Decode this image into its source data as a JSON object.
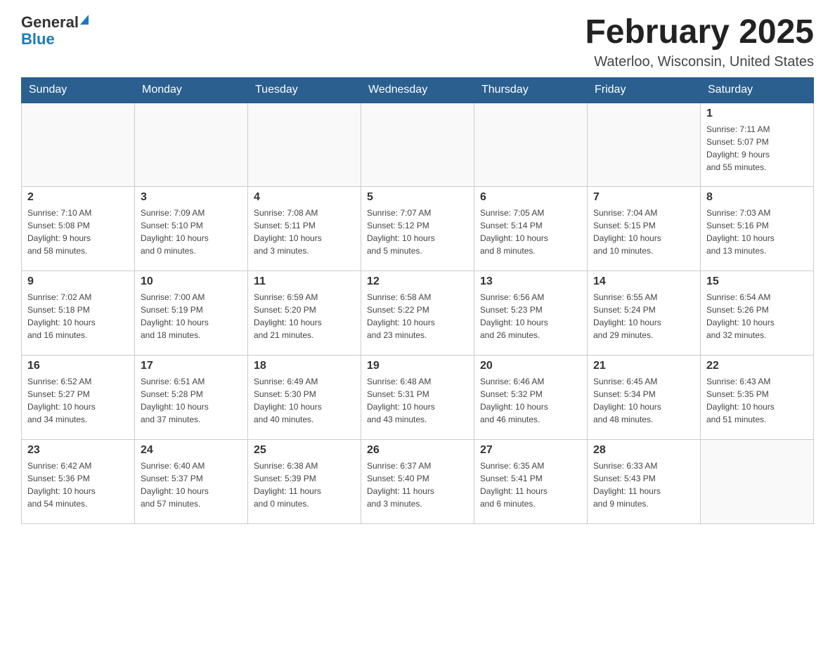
{
  "header": {
    "logo_general": "General",
    "logo_blue": "Blue",
    "title": "February 2025",
    "subtitle": "Waterloo, Wisconsin, United States"
  },
  "weekdays": [
    "Sunday",
    "Monday",
    "Tuesday",
    "Wednesday",
    "Thursday",
    "Friday",
    "Saturday"
  ],
  "weeks": [
    {
      "days": [
        {
          "number": "",
          "info": ""
        },
        {
          "number": "",
          "info": ""
        },
        {
          "number": "",
          "info": ""
        },
        {
          "number": "",
          "info": ""
        },
        {
          "number": "",
          "info": ""
        },
        {
          "number": "",
          "info": ""
        },
        {
          "number": "1",
          "info": "Sunrise: 7:11 AM\nSunset: 5:07 PM\nDaylight: 9 hours\nand 55 minutes."
        }
      ]
    },
    {
      "days": [
        {
          "number": "2",
          "info": "Sunrise: 7:10 AM\nSunset: 5:08 PM\nDaylight: 9 hours\nand 58 minutes."
        },
        {
          "number": "3",
          "info": "Sunrise: 7:09 AM\nSunset: 5:10 PM\nDaylight: 10 hours\nand 0 minutes."
        },
        {
          "number": "4",
          "info": "Sunrise: 7:08 AM\nSunset: 5:11 PM\nDaylight: 10 hours\nand 3 minutes."
        },
        {
          "number": "5",
          "info": "Sunrise: 7:07 AM\nSunset: 5:12 PM\nDaylight: 10 hours\nand 5 minutes."
        },
        {
          "number": "6",
          "info": "Sunrise: 7:05 AM\nSunset: 5:14 PM\nDaylight: 10 hours\nand 8 minutes."
        },
        {
          "number": "7",
          "info": "Sunrise: 7:04 AM\nSunset: 5:15 PM\nDaylight: 10 hours\nand 10 minutes."
        },
        {
          "number": "8",
          "info": "Sunrise: 7:03 AM\nSunset: 5:16 PM\nDaylight: 10 hours\nand 13 minutes."
        }
      ]
    },
    {
      "days": [
        {
          "number": "9",
          "info": "Sunrise: 7:02 AM\nSunset: 5:18 PM\nDaylight: 10 hours\nand 16 minutes."
        },
        {
          "number": "10",
          "info": "Sunrise: 7:00 AM\nSunset: 5:19 PM\nDaylight: 10 hours\nand 18 minutes."
        },
        {
          "number": "11",
          "info": "Sunrise: 6:59 AM\nSunset: 5:20 PM\nDaylight: 10 hours\nand 21 minutes."
        },
        {
          "number": "12",
          "info": "Sunrise: 6:58 AM\nSunset: 5:22 PM\nDaylight: 10 hours\nand 23 minutes."
        },
        {
          "number": "13",
          "info": "Sunrise: 6:56 AM\nSunset: 5:23 PM\nDaylight: 10 hours\nand 26 minutes."
        },
        {
          "number": "14",
          "info": "Sunrise: 6:55 AM\nSunset: 5:24 PM\nDaylight: 10 hours\nand 29 minutes."
        },
        {
          "number": "15",
          "info": "Sunrise: 6:54 AM\nSunset: 5:26 PM\nDaylight: 10 hours\nand 32 minutes."
        }
      ]
    },
    {
      "days": [
        {
          "number": "16",
          "info": "Sunrise: 6:52 AM\nSunset: 5:27 PM\nDaylight: 10 hours\nand 34 minutes."
        },
        {
          "number": "17",
          "info": "Sunrise: 6:51 AM\nSunset: 5:28 PM\nDaylight: 10 hours\nand 37 minutes."
        },
        {
          "number": "18",
          "info": "Sunrise: 6:49 AM\nSunset: 5:30 PM\nDaylight: 10 hours\nand 40 minutes."
        },
        {
          "number": "19",
          "info": "Sunrise: 6:48 AM\nSunset: 5:31 PM\nDaylight: 10 hours\nand 43 minutes."
        },
        {
          "number": "20",
          "info": "Sunrise: 6:46 AM\nSunset: 5:32 PM\nDaylight: 10 hours\nand 46 minutes."
        },
        {
          "number": "21",
          "info": "Sunrise: 6:45 AM\nSunset: 5:34 PM\nDaylight: 10 hours\nand 48 minutes."
        },
        {
          "number": "22",
          "info": "Sunrise: 6:43 AM\nSunset: 5:35 PM\nDaylight: 10 hours\nand 51 minutes."
        }
      ]
    },
    {
      "days": [
        {
          "number": "23",
          "info": "Sunrise: 6:42 AM\nSunset: 5:36 PM\nDaylight: 10 hours\nand 54 minutes."
        },
        {
          "number": "24",
          "info": "Sunrise: 6:40 AM\nSunset: 5:37 PM\nDaylight: 10 hours\nand 57 minutes."
        },
        {
          "number": "25",
          "info": "Sunrise: 6:38 AM\nSunset: 5:39 PM\nDaylight: 11 hours\nand 0 minutes."
        },
        {
          "number": "26",
          "info": "Sunrise: 6:37 AM\nSunset: 5:40 PM\nDaylight: 11 hours\nand 3 minutes."
        },
        {
          "number": "27",
          "info": "Sunrise: 6:35 AM\nSunset: 5:41 PM\nDaylight: 11 hours\nand 6 minutes."
        },
        {
          "number": "28",
          "info": "Sunrise: 6:33 AM\nSunset: 5:43 PM\nDaylight: 11 hours\nand 9 minutes."
        },
        {
          "number": "",
          "info": ""
        }
      ]
    }
  ]
}
